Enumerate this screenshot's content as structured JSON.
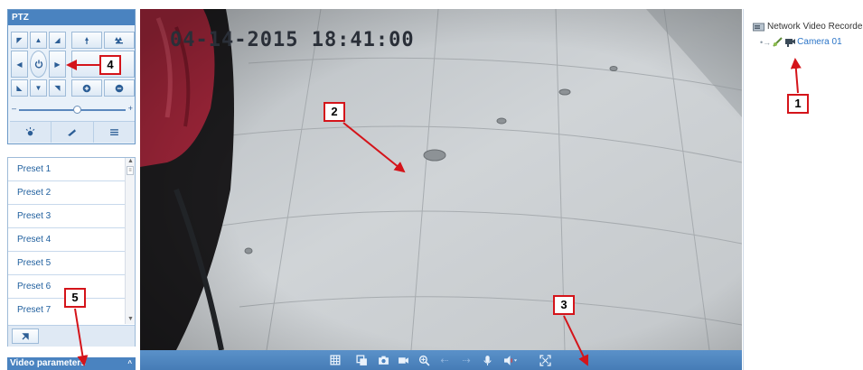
{
  "ptz": {
    "title": "PTZ",
    "speed_fraction": 0.55
  },
  "presets": {
    "items": [
      "Preset 1",
      "Preset 2",
      "Preset 3",
      "Preset 4",
      "Preset 5",
      "Preset 6",
      "Preset 7"
    ]
  },
  "video_parameters": {
    "label": "Video parameters"
  },
  "video": {
    "timestamp": "04-14-2015 18:41:00"
  },
  "device_tree": {
    "root_label": "Network Video Recorder",
    "camera_label": "Camera 01"
  },
  "callouts": [
    "1",
    "2",
    "3",
    "4",
    "5"
  ],
  "colors": {
    "panel_blue": "#4a83c0",
    "link_blue": "#2a74c7",
    "callout_red": "#d4141a"
  },
  "icons": {
    "ptz": [
      "arrow-up-left-icon",
      "arrow-up-icon",
      "arrow-up-right-icon",
      "zoom-in-icon",
      "zoom-out-icon",
      "arrow-left-icon",
      "auto-pan-icon",
      "arrow-right-icon",
      "stop-icon",
      "arrow-down-left-icon",
      "arrow-down-icon",
      "arrow-down-right-icon",
      "focus-near-icon",
      "focus-far-icon",
      "light-icon",
      "wiper-icon",
      "menu-icon"
    ],
    "toolbar": [
      "layout-icon",
      "stop-all-icon",
      "capture-icon",
      "record-icon",
      "digital-zoom-icon",
      "previous-icon",
      "next-icon",
      "microphone-icon",
      "volume-icon",
      "fullscreen-icon"
    ]
  }
}
